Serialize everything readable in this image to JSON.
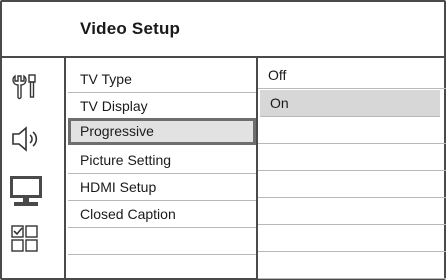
{
  "header": {
    "title": "Video Setup"
  },
  "icons": [
    {
      "name": "general-setup-icon"
    },
    {
      "name": "audio-setup-icon"
    },
    {
      "name": "video-setup-icon"
    },
    {
      "name": "preference-setup-icon"
    }
  ],
  "menu": {
    "items": [
      {
        "label": "TV Type"
      },
      {
        "label": "TV Display"
      },
      {
        "label": "Progressive"
      },
      {
        "label": "Picture Setting"
      },
      {
        "label": "HDMI Setup"
      },
      {
        "label": "Closed Caption"
      }
    ],
    "selected": "Progressive"
  },
  "options": {
    "items": [
      {
        "label": "Off"
      },
      {
        "label": "On"
      }
    ],
    "selected": "On"
  }
}
